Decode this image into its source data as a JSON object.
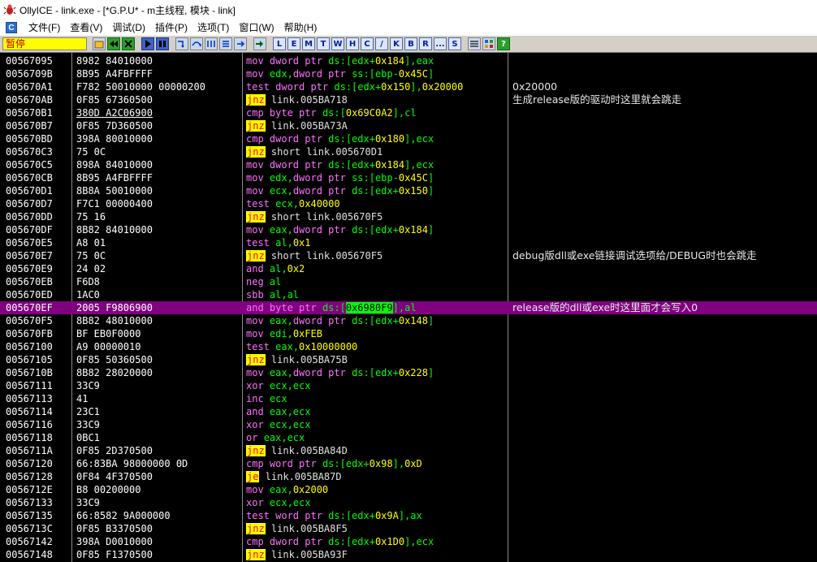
{
  "window": {
    "title": "OllyICE - link.exe - [*G.P.U* - m主线程, 模块 - link]"
  },
  "menu": [
    "文件(F)",
    "查看(V)",
    "调试(D)",
    "插件(P)",
    "选项(T)",
    "窗口(W)",
    "帮助(H)"
  ],
  "toolbar": {
    "status": "暂停",
    "letters": [
      "L",
      "E",
      "M",
      "T",
      "W",
      "H",
      "C",
      "/",
      "K",
      "B",
      "R",
      "...",
      "S"
    ]
  },
  "colors": {
    "selected_row": "#800080",
    "status_bg": "#ffff00",
    "status_text": "#c00000",
    "jump_bg": "#ffff00"
  },
  "rows": [
    {
      "addr": "00567095",
      "hex": "8982 84010000",
      "asm": [
        [
          "mn",
          "mov "
        ],
        [
          "sz",
          "dword ptr "
        ],
        [
          "reg",
          "ds:[edx+"
        ],
        [
          "num",
          "0x184"
        ],
        [
          "reg",
          "],eax"
        ]
      ],
      "cmt": ""
    },
    {
      "addr": "0056709B",
      "hex": "8B95 A4FBFFFF",
      "asm": [
        [
          "mn",
          "mov "
        ],
        [
          "reg",
          "edx,"
        ],
        [
          "sz",
          "dword ptr "
        ],
        [
          "reg",
          "ss:[ebp-"
        ],
        [
          "num",
          "0x45C"
        ],
        [
          "reg",
          "]"
        ]
      ],
      "cmt": ""
    },
    {
      "addr": "005670A1",
      "hex": "F782 50010000 00000200",
      "asm": [
        [
          "mn",
          "test "
        ],
        [
          "sz",
          "dword ptr "
        ],
        [
          "reg",
          "ds:[edx+"
        ],
        [
          "num",
          "0x150"
        ],
        [
          "reg",
          "],"
        ],
        [
          "num",
          "0x20000"
        ]
      ],
      "cmt": "0x20000"
    },
    {
      "addr": "005670AB",
      "hex": "0F85 67360500",
      "asm": [
        [
          "jmp",
          "jnz"
        ],
        [
          "pl",
          " link.005BA718"
        ]
      ],
      "cmt": "生成release版的驱动时这里就会跳走"
    },
    {
      "addr": "005670B1",
      "hex": "380D A2C06900",
      "hexul": true,
      "asm": [
        [
          "mn",
          "cmp "
        ],
        [
          "sz",
          "byte ptr "
        ],
        [
          "reg",
          "ds:["
        ],
        [
          "num",
          "0x69C0A2"
        ],
        [
          "reg",
          "],cl"
        ]
      ],
      "cmt": ""
    },
    {
      "addr": "005670B7",
      "hex": "0F85 7D360500",
      "asm": [
        [
          "jmp",
          "jnz"
        ],
        [
          "pl",
          " link.005BA73A"
        ]
      ],
      "cmt": ""
    },
    {
      "addr": "005670BD",
      "hex": "398A 80010000",
      "asm": [
        [
          "mn",
          "cmp "
        ],
        [
          "sz",
          "dword ptr "
        ],
        [
          "reg",
          "ds:[edx+"
        ],
        [
          "num",
          "0x180"
        ],
        [
          "reg",
          "],ecx"
        ]
      ],
      "cmt": ""
    },
    {
      "addr": "005670C3",
      "hex": "75 0C",
      "asm": [
        [
          "jmp",
          "jnz"
        ],
        [
          "pl",
          " short link.005670D1"
        ]
      ],
      "cmt": ""
    },
    {
      "addr": "005670C5",
      "hex": "898A 84010000",
      "asm": [
        [
          "mn",
          "mov "
        ],
        [
          "sz",
          "dword ptr "
        ],
        [
          "reg",
          "ds:[edx+"
        ],
        [
          "num",
          "0x184"
        ],
        [
          "reg",
          "],ecx"
        ]
      ],
      "cmt": ""
    },
    {
      "addr": "005670CB",
      "hex": "8B95 A4FBFFFF",
      "asm": [
        [
          "mn",
          "mov "
        ],
        [
          "reg",
          "edx,"
        ],
        [
          "sz",
          "dword ptr "
        ],
        [
          "reg",
          "ss:[ebp-"
        ],
        [
          "num",
          "0x45C"
        ],
        [
          "reg",
          "]"
        ]
      ],
      "cmt": ""
    },
    {
      "addr": "005670D1",
      "hex": "8B8A 50010000",
      "asm": [
        [
          "mn",
          "mov "
        ],
        [
          "reg",
          "ecx,"
        ],
        [
          "sz",
          "dword ptr "
        ],
        [
          "reg",
          "ds:[edx+"
        ],
        [
          "num",
          "0x150"
        ],
        [
          "reg",
          "]"
        ]
      ],
      "cmt": ""
    },
    {
      "addr": "005670D7",
      "hex": "F7C1 00000400",
      "asm": [
        [
          "mn",
          "test "
        ],
        [
          "reg",
          "ecx,"
        ],
        [
          "num",
          "0x40000"
        ]
      ],
      "cmt": ""
    },
    {
      "addr": "005670DD",
      "hex": "75 16",
      "asm": [
        [
          "jmp",
          "jnz"
        ],
        [
          "pl",
          " short link.005670F5"
        ]
      ],
      "cmt": ""
    },
    {
      "addr": "005670DF",
      "hex": "8B82 84010000",
      "asm": [
        [
          "mn",
          "mov "
        ],
        [
          "reg",
          "eax,"
        ],
        [
          "sz",
          "dword ptr "
        ],
        [
          "reg",
          "ds:[edx+"
        ],
        [
          "num",
          "0x184"
        ],
        [
          "reg",
          "]"
        ]
      ],
      "cmt": ""
    },
    {
      "addr": "005670E5",
      "hex": "A8 01",
      "asm": [
        [
          "mn",
          "test "
        ],
        [
          "reg",
          "al,"
        ],
        [
          "num",
          "0x1"
        ]
      ],
      "cmt": ""
    },
    {
      "addr": "005670E7",
      "hex": "75 0C",
      "asm": [
        [
          "jmp",
          "jnz"
        ],
        [
          "pl",
          " short link.005670F5"
        ]
      ],
      "cmt": "debug版dll或exe链接调试选项给/DEBUG时也会跳走"
    },
    {
      "addr": "005670E9",
      "hex": "24 02",
      "asm": [
        [
          "mn",
          "and "
        ],
        [
          "reg",
          "al,"
        ],
        [
          "num",
          "0x2"
        ]
      ],
      "cmt": ""
    },
    {
      "addr": "005670EB",
      "hex": "F6D8",
      "asm": [
        [
          "mn",
          "neg "
        ],
        [
          "reg",
          "al"
        ]
      ],
      "cmt": ""
    },
    {
      "addr": "005670ED",
      "hex": "1AC0",
      "asm": [
        [
          "mn",
          "sbb "
        ],
        [
          "reg",
          "al,al"
        ]
      ],
      "cmt": ""
    },
    {
      "addr": "005670EF",
      "hex": "2005 F9806900",
      "sel": true,
      "asm": [
        [
          "mn",
          "and "
        ],
        [
          "sz",
          "byte ptr "
        ],
        [
          "reg",
          "ds:["
        ],
        [
          "hl",
          "0x6980F9"
        ],
        [
          "reg",
          "],al"
        ]
      ],
      "cmt": "release版的dll或exe时这里面才会写入0"
    },
    {
      "addr": "005670F5",
      "hex": "8B82 48010000",
      "asm": [
        [
          "mn",
          "mov "
        ],
        [
          "reg",
          "eax,"
        ],
        [
          "sz",
          "dword ptr "
        ],
        [
          "reg",
          "ds:[edx+"
        ],
        [
          "num",
          "0x148"
        ],
        [
          "reg",
          "]"
        ]
      ],
      "cmt": ""
    },
    {
      "addr": "005670FB",
      "hex": "BF EB0F0000",
      "asm": [
        [
          "mn",
          "mov "
        ],
        [
          "reg",
          "edi,"
        ],
        [
          "num",
          "0xFEB"
        ]
      ],
      "cmt": ""
    },
    {
      "addr": "00567100",
      "hex": "A9 00000010",
      "asm": [
        [
          "mn",
          "test "
        ],
        [
          "reg",
          "eax,"
        ],
        [
          "num",
          "0x10000000"
        ]
      ],
      "cmt": ""
    },
    {
      "addr": "00567105",
      "hex": "0F85 50360500",
      "asm": [
        [
          "jmp",
          "jnz"
        ],
        [
          "pl",
          " link.005BA75B"
        ]
      ],
      "cmt": ""
    },
    {
      "addr": "0056710B",
      "hex": "8B82 28020000",
      "asm": [
        [
          "mn",
          "mov "
        ],
        [
          "reg",
          "eax,"
        ],
        [
          "sz",
          "dword ptr "
        ],
        [
          "reg",
          "ds:[edx+"
        ],
        [
          "num",
          "0x228"
        ],
        [
          "reg",
          "]"
        ]
      ],
      "cmt": ""
    },
    {
      "addr": "00567111",
      "hex": "33C9",
      "asm": [
        [
          "mn",
          "xor "
        ],
        [
          "reg",
          "ecx,ecx"
        ]
      ],
      "cmt": ""
    },
    {
      "addr": "00567113",
      "hex": "41",
      "asm": [
        [
          "mn",
          "inc "
        ],
        [
          "reg",
          "ecx"
        ]
      ],
      "cmt": ""
    },
    {
      "addr": "00567114",
      "hex": "23C1",
      "asm": [
        [
          "mn",
          "and "
        ],
        [
          "reg",
          "eax,ecx"
        ]
      ],
      "cmt": ""
    },
    {
      "addr": "00567116",
      "hex": "33C9",
      "asm": [
        [
          "mn",
          "xor "
        ],
        [
          "reg",
          "ecx,ecx"
        ]
      ],
      "cmt": ""
    },
    {
      "addr": "00567118",
      "hex": "0BC1",
      "asm": [
        [
          "mn",
          "or "
        ],
        [
          "reg",
          "eax,ecx"
        ]
      ],
      "cmt": ""
    },
    {
      "addr": "0056711A",
      "hex": "0F85 2D370500",
      "asm": [
        [
          "jmp",
          "jnz"
        ],
        [
          "pl",
          " link.005BA84D"
        ]
      ],
      "cmt": ""
    },
    {
      "addr": "00567120",
      "hex": "66:83BA 98000000 0D",
      "asm": [
        [
          "mn",
          "cmp "
        ],
        [
          "sz",
          "word ptr "
        ],
        [
          "reg",
          "ds:[edx+"
        ],
        [
          "num",
          "0x98"
        ],
        [
          "reg",
          "],"
        ],
        [
          "num",
          "0xD"
        ]
      ],
      "cmt": ""
    },
    {
      "addr": "00567128",
      "hex": "0F84 4F370500",
      "asm": [
        [
          "jmp",
          "je"
        ],
        [
          "pl",
          " link.005BA87D"
        ]
      ],
      "cmt": ""
    },
    {
      "addr": "0056712E",
      "hex": "B8 00200000",
      "asm": [
        [
          "mn",
          "mov "
        ],
        [
          "reg",
          "eax,"
        ],
        [
          "num",
          "0x2000"
        ]
      ],
      "cmt": ""
    },
    {
      "addr": "00567133",
      "hex": "33C9",
      "asm": [
        [
          "mn",
          "xor "
        ],
        [
          "reg",
          "ecx,ecx"
        ]
      ],
      "cmt": ""
    },
    {
      "addr": "00567135",
      "hex": "66:8582 9A000000",
      "asm": [
        [
          "mn",
          "test "
        ],
        [
          "sz",
          "word ptr "
        ],
        [
          "reg",
          "ds:[edx+"
        ],
        [
          "num",
          "0x9A"
        ],
        [
          "reg",
          "],ax"
        ]
      ],
      "cmt": ""
    },
    {
      "addr": "0056713C",
      "hex": "0F85 B3370500",
      "asm": [
        [
          "jmp",
          "jnz"
        ],
        [
          "pl",
          " link.005BA8F5"
        ]
      ],
      "cmt": ""
    },
    {
      "addr": "00567142",
      "hex": "398A D0010000",
      "asm": [
        [
          "mn",
          "cmp "
        ],
        [
          "sz",
          "dword ptr "
        ],
        [
          "reg",
          "ds:[edx+"
        ],
        [
          "num",
          "0x1D0"
        ],
        [
          "reg",
          "],ecx"
        ]
      ],
      "cmt": ""
    },
    {
      "addr": "00567148",
      "hex": "0F85 F1370500",
      "asm": [
        [
          "jmp",
          "jnz"
        ],
        [
          "pl",
          " link.005BA93F"
        ]
      ],
      "cmt": ""
    }
  ]
}
